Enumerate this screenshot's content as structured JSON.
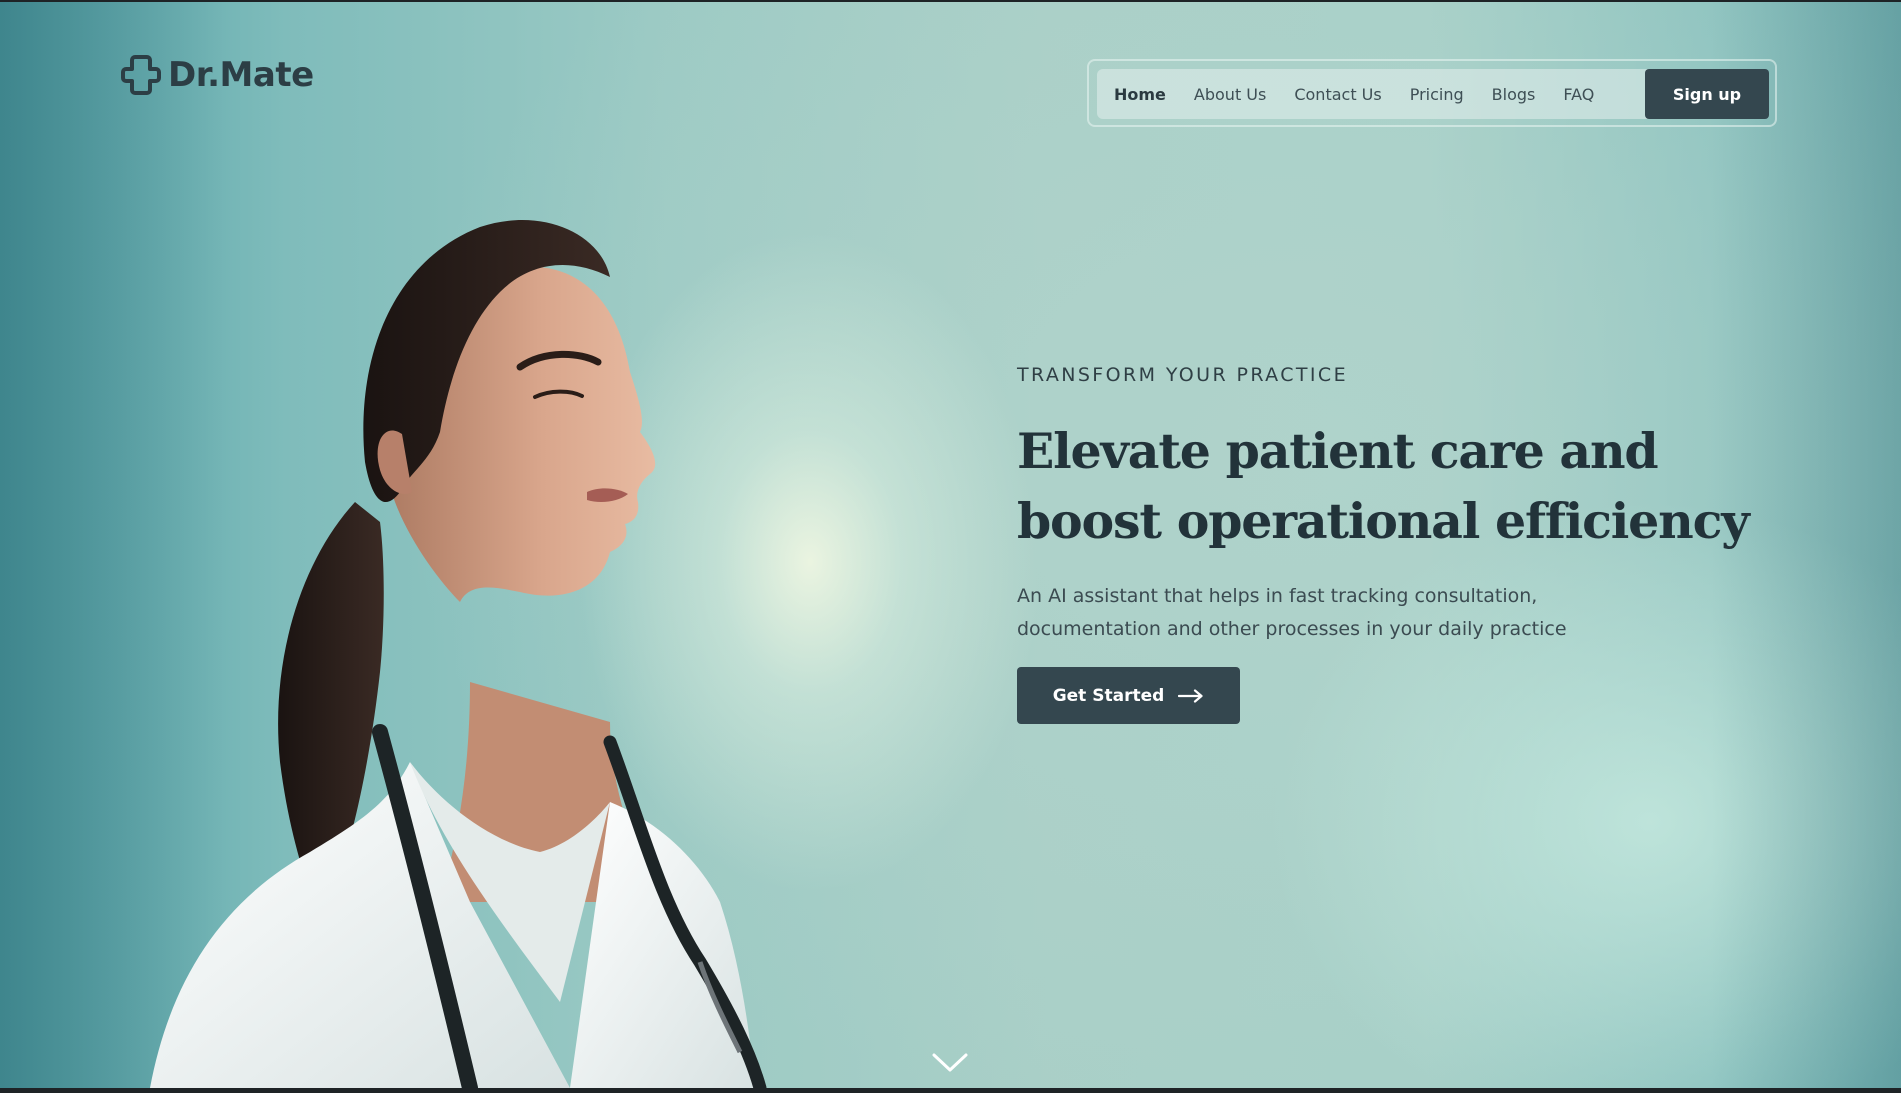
{
  "brand": {
    "name": "Dr.Mate",
    "logo_icon": "medical-cross-icon"
  },
  "nav": {
    "links": [
      "Home",
      "About Us",
      "Contact Us",
      "Pricing",
      "Blogs",
      "FAQ"
    ],
    "active": "Home",
    "signup_label": "Sign up"
  },
  "hero": {
    "eyebrow": "TRANSFORM YOUR PRACTICE",
    "headline_line1": "Elevate patient care and",
    "headline_line2": "boost operational efficiency",
    "subtitle_line1": "An AI assistant that helps in fast tracking consultation,",
    "subtitle_line2": "documentation and other processes in your daily practice",
    "cta_label": "Get Started",
    "cta_icon": "arrow-right-icon"
  },
  "scroll_indicator": {
    "icon": "chevron-down-icon"
  },
  "colors": {
    "primary_dark": "#34474f",
    "text_dark": "#22333a",
    "background_teal": "#9ccac4",
    "highlight_glow": "#eef6e2"
  }
}
